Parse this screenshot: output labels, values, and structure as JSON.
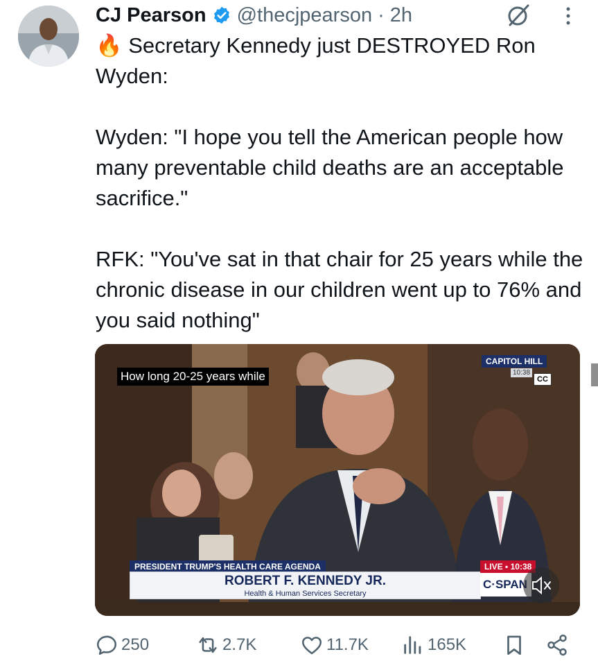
{
  "tweet": {
    "author": {
      "name": "CJ Pearson",
      "handle": "@thecjpearson",
      "separator": "·",
      "time": "2h"
    },
    "text": "🔥 Secretary Kennedy just DESTROYED Ron Wyden:\n\nWyden: \"I hope you tell the American people how many preventable child deaths are an acceptable sacrifice.\"\n\nRFK: \"You've sat in that chair for 25 years while the chronic disease in our children went up to 76% and you said nothing\"",
    "media": {
      "caption": "How long 20-25 years while",
      "cc_label": "CC",
      "location_label": "CAPITOL HILL",
      "location_time": "10:38",
      "lower_third_tag": "PRESIDENT TRUMP'S HEALTH CARE AGENDA",
      "lower_third_name": "ROBERT F. KENNEDY JR.",
      "lower_third_title": "Health & Human Services Secretary",
      "live_label": "LIVE ▪ 10:38",
      "network_label": "C·SPAN"
    },
    "stats": {
      "replies": "250",
      "reposts": "2.7K",
      "likes": "11.7K",
      "views": "165K"
    },
    "colors": {
      "verified": "#1d9bf0",
      "secondary_text": "#536471",
      "text": "#0f1419"
    }
  }
}
